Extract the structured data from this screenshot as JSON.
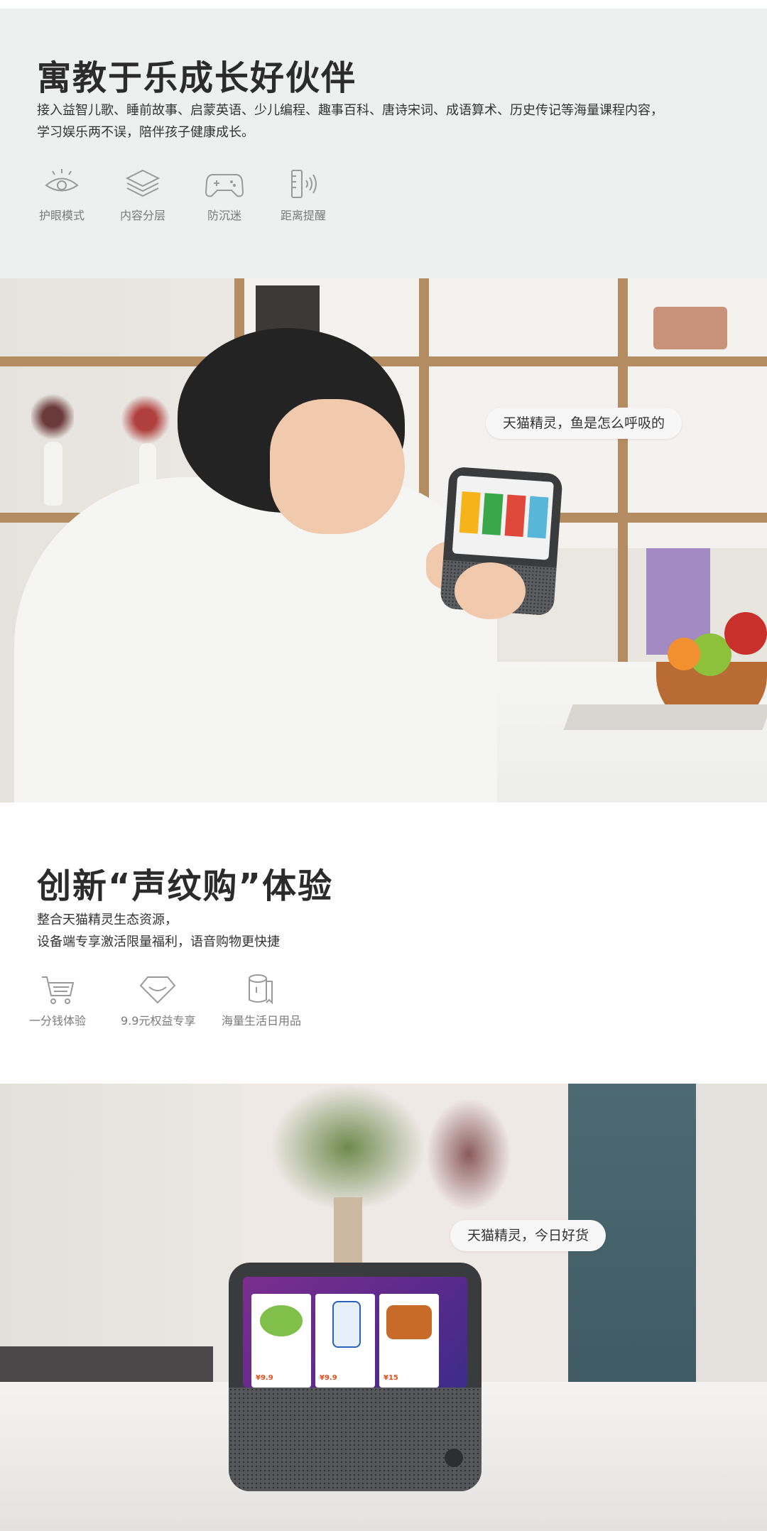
{
  "section1": {
    "title": "寓教于乐成长好伙伴",
    "description_lines": [
      "接入益智儿歌、睡前故事、启蒙英语、少儿编程、趣事百科、唐诗宋词、成语算术、历史传记等海量课程内容，",
      "学习娱乐两不误，陪伴孩子健康成长。"
    ],
    "features": [
      {
        "icon": "eye-icon",
        "label": "护眼模式"
      },
      {
        "icon": "layers-icon",
        "label": "内容分层"
      },
      {
        "icon": "gamepad-icon",
        "label": "防沉迷"
      },
      {
        "icon": "distance-sensor-icon",
        "label": "距离提醒"
      }
    ]
  },
  "photo1": {
    "bubble_text": "天猫精灵，鱼是怎么呼吸的"
  },
  "section2": {
    "title": "创新“声纹购”体验",
    "description_lines": [
      "整合天猫精灵生态资源，",
      "设备端专享激活限量福利，语音购物更快捷"
    ],
    "features": [
      {
        "icon": "cart-icon",
        "label": "一分钱体验"
      },
      {
        "icon": "diamond-icon",
        "label": "9.9元权益专享"
      },
      {
        "icon": "tissue-roll-icon",
        "label": "海量生活日用品"
      }
    ]
  },
  "photo2": {
    "bubble_text": "天猫精灵，今日好货",
    "screen_prices": [
      "¥9.9",
      "¥9.9",
      "¥15"
    ]
  },
  "colors": {
    "section_bg": "#eef0ef",
    "title_text": "#2b2b2b",
    "label_text": "#7a7a7a",
    "price_accent": "#e0501c"
  }
}
